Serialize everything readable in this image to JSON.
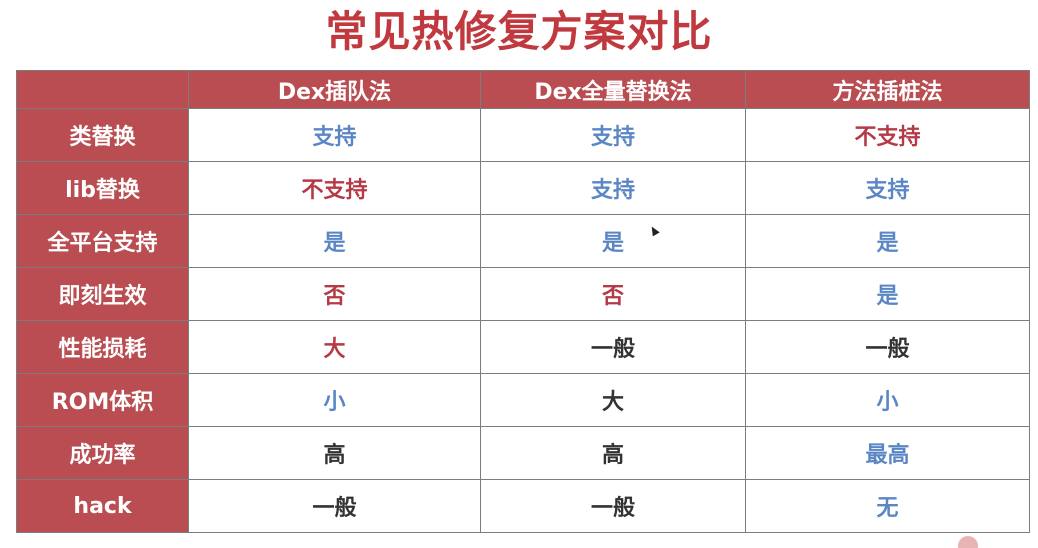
{
  "title": "常见热修复方案对比",
  "table": {
    "headers": [
      "",
      "Dex插队法",
      "Dex全量替换法",
      "方法插桩法"
    ],
    "rows": [
      {
        "label": "类替换",
        "cells": [
          {
            "text": "支持",
            "tone": "blue"
          },
          {
            "text": "支持",
            "tone": "blue"
          },
          {
            "text": "不支持",
            "tone": "red"
          }
        ]
      },
      {
        "label": "lib替换",
        "cells": [
          {
            "text": "不支持",
            "tone": "red"
          },
          {
            "text": "支持",
            "tone": "blue"
          },
          {
            "text": "支持",
            "tone": "blue"
          }
        ]
      },
      {
        "label": "全平台支持",
        "cells": [
          {
            "text": "是",
            "tone": "blue"
          },
          {
            "text": "是",
            "tone": "blue"
          },
          {
            "text": "是",
            "tone": "blue"
          }
        ]
      },
      {
        "label": "即刻生效",
        "cells": [
          {
            "text": "否",
            "tone": "red"
          },
          {
            "text": "否",
            "tone": "red"
          },
          {
            "text": "是",
            "tone": "blue"
          }
        ]
      },
      {
        "label": "性能损耗",
        "cells": [
          {
            "text": "大",
            "tone": "red"
          },
          {
            "text": "一般",
            "tone": "black"
          },
          {
            "text": "一般",
            "tone": "black"
          }
        ]
      },
      {
        "label": "ROM体积",
        "cells": [
          {
            "text": "小",
            "tone": "blue"
          },
          {
            "text": "大",
            "tone": "black"
          },
          {
            "text": "小",
            "tone": "blue"
          }
        ]
      },
      {
        "label": "成功率",
        "cells": [
          {
            "text": "高",
            "tone": "black"
          },
          {
            "text": "高",
            "tone": "black"
          },
          {
            "text": "最高",
            "tone": "blue"
          }
        ]
      },
      {
        "label": "hack",
        "cells": [
          {
            "text": "一般",
            "tone": "black"
          },
          {
            "text": "一般",
            "tone": "black"
          },
          {
            "text": "无",
            "tone": "blue"
          }
        ]
      }
    ]
  },
  "colors": {
    "title": "#c0393f",
    "header_bg": "#b94d51",
    "header_text": "#ffffff",
    "blue": "#5b86c5",
    "red": "#b43a46",
    "black": "#333333",
    "border": "#7c7c7c"
  },
  "icons": {
    "cursor": "mouse-pointer-icon"
  }
}
